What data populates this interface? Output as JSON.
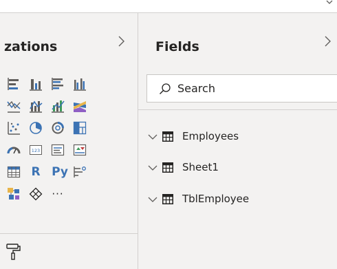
{
  "visualizations": {
    "title": "zations",
    "icons": [
      [
        "stacked-bar-chart-icon",
        "stacked-column-chart-icon",
        "clustered-bar-chart-icon",
        "clustered-column-chart-icon"
      ],
      [
        "line-chart-icon",
        "area-chart-icon",
        "line-and-column-chart-icon",
        "ribbon-chart-icon"
      ],
      [
        "scatter-chart-icon",
        "pie-chart-icon",
        "donut-chart-icon",
        "treemap-icon"
      ],
      [
        "gauge-icon",
        "card-icon",
        "multi-row-card-icon",
        "kpi-icon"
      ],
      [
        "table-visual-icon",
        "r-visual-icon",
        "python-visual-icon",
        "key-influencers-icon"
      ],
      [
        "decomposition-tree-icon",
        "custom-visual-icon",
        "more-visuals-icon"
      ]
    ],
    "r_label": "R",
    "py_label": "Py",
    "more_label": "···",
    "format_icon": "paint-roller-icon"
  },
  "fields": {
    "title": "Fields",
    "search_placeholder": "Search",
    "tables": [
      {
        "name": "Employees"
      },
      {
        "name": "Sheet1"
      },
      {
        "name": "TblEmployee"
      }
    ]
  },
  "colors": {
    "pane_bg": "#f3f2f1",
    "border": "#d2d0ce",
    "icon_dark": "#605e5c",
    "icon_blue": "#3c73b4",
    "icon_purple": "#8f5fc4",
    "icon_yellow": "#e8b54a",
    "icon_green": "#3e9b5a",
    "icon_red": "#c03b3b"
  }
}
